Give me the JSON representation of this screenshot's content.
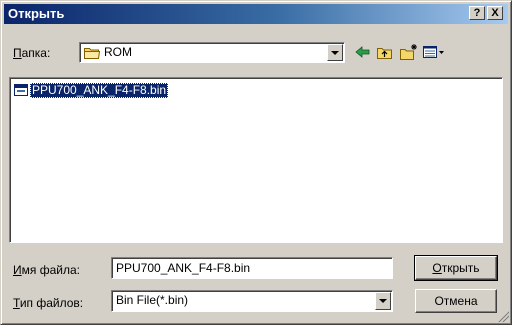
{
  "window": {
    "title": "Открыть"
  },
  "titlebar": {
    "help_label": "?",
    "close_label": "X"
  },
  "look_in": {
    "label_accel": "П",
    "label_rest": "апка:",
    "value": "ROM"
  },
  "toolbar": {
    "back_icon": "back-arrow-icon",
    "up_icon": "up-folder-icon",
    "new_folder_icon": "new-folder-icon",
    "view_menu_icon": "view-menu-icon"
  },
  "files": [
    {
      "name": "PPU700_ANK_F4-F8.bin",
      "selected": true,
      "icon": "bin-file-icon"
    }
  ],
  "filename": {
    "label_accel": "И",
    "label_rest": "мя файла:",
    "value": "PPU700_ANK_F4-F8.bin"
  },
  "filetype": {
    "label_accel": "Т",
    "label_rest": "ип файлов:",
    "value": "Bin File(*.bin)"
  },
  "buttons": {
    "open_accel": "О",
    "open_rest": "ткрыть",
    "cancel": "Отмена"
  },
  "colors": {
    "selection": "#0a246a",
    "face": "#d4d0c8",
    "title_gradient_start": "#0a246a"
  }
}
